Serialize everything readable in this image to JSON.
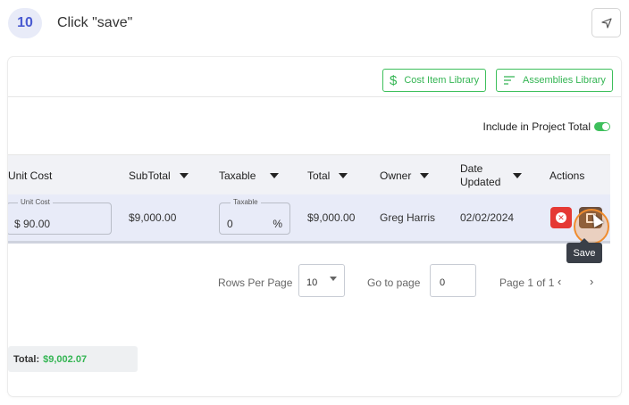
{
  "step": {
    "number": "10",
    "instruction": "Click \"save\""
  },
  "toolbar": {
    "cost_item_library": "Cost Item Library",
    "assemblies_library": "Assemblies Library",
    "include_in_project_total": "Include in Project Total",
    "include_toggle_on": true
  },
  "table": {
    "headers": {
      "unit_cost": "Unit Cost",
      "subtotal": "SubTotal",
      "taxable": "Taxable",
      "total": "Total",
      "owner": "Owner",
      "date_updated_1": "Date",
      "date_updated_2": "Updated",
      "actions": "Actions"
    },
    "row": {
      "unit_cost_label": "Unit Cost",
      "unit_cost_value": "$ 90.00",
      "subtotal": "$9,000.00",
      "taxable_label": "Taxable",
      "taxable_value": "0",
      "taxable_suffix": "%",
      "total": "$9,000.00",
      "owner": "Greg Harris",
      "date_updated": "02/02/2024"
    },
    "save_tooltip": "Save"
  },
  "pagination": {
    "rows_per_page_label": "Rows Per Page",
    "rows_per_page_value": "10",
    "go_to_page_label": "Go to page",
    "go_to_page_value": "0",
    "page_info": "Page 1 of 1",
    "prev": "‹",
    "next": "›"
  },
  "summary": {
    "total_label": "Total:",
    "total_value": "$9,002.07"
  },
  "colors": {
    "accent_green": "#34b553",
    "delete_red": "#e53935",
    "highlight_orange": "#f08c2e",
    "row_highlight": "#e8ebf8"
  }
}
